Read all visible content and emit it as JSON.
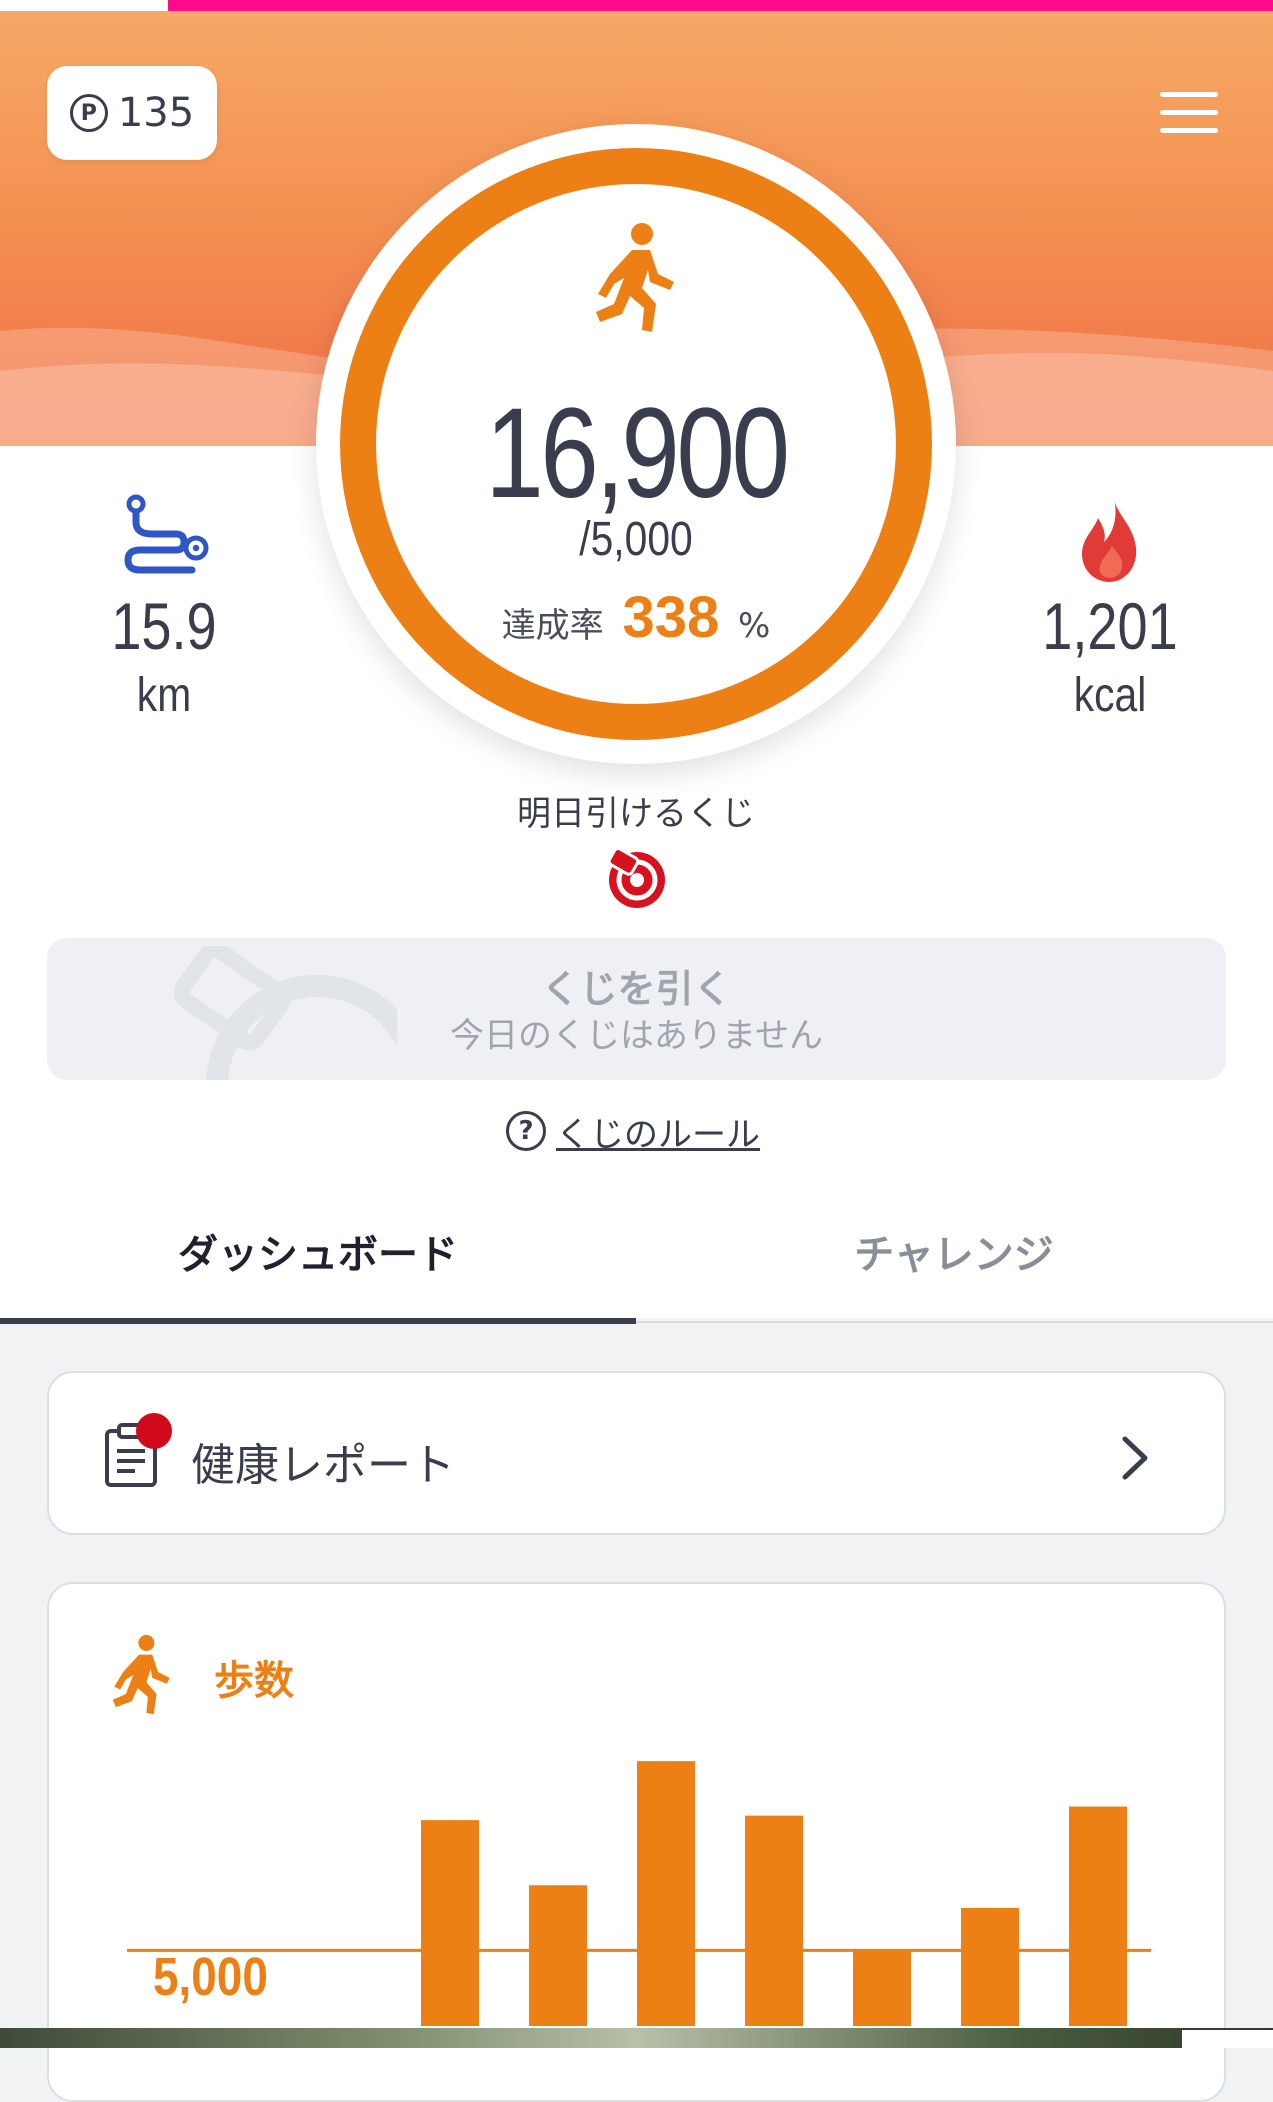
{
  "header": {
    "points_symbol": "P",
    "points": "135"
  },
  "summary": {
    "steps": "16,900",
    "goal": "/5,000",
    "rate_label": "達成率",
    "rate_value": "338",
    "rate_unit": "%",
    "distance": {
      "value": "15.9",
      "unit": "km"
    },
    "calories": {
      "value": "1,201",
      "unit": "kcal"
    }
  },
  "lottery": {
    "tomorrow_label": "明日引けるくじ",
    "draw_label": "くじを引く",
    "draw_sub": "今日のくじはありません",
    "rules_label": "くじのルール",
    "rules_symbol": "?"
  },
  "tabs": [
    {
      "label": "ダッシュボード",
      "active": true
    },
    {
      "label": "チャレンジ",
      "active": false
    }
  ],
  "report": {
    "title": "健康レポート",
    "has_notification": true
  },
  "steps_chart": {
    "title": "歩数",
    "goal_label": "5,000"
  },
  "colors": {
    "accent": "#ec8015",
    "text": "#3a3d4d",
    "notification": "#d00a1b",
    "top_bar": "#ff0a8a"
  },
  "chart_data": {
    "type": "bar",
    "categories": [
      "",
      "",
      "",
      "",
      "",
      "",
      ""
    ],
    "values": [
      13600,
      9300,
      17500,
      13900,
      5000,
      7800,
      14500
    ],
    "reference_line": 5000,
    "ylim": [
      0,
      18500
    ],
    "xlabel": "",
    "ylabel": ""
  }
}
